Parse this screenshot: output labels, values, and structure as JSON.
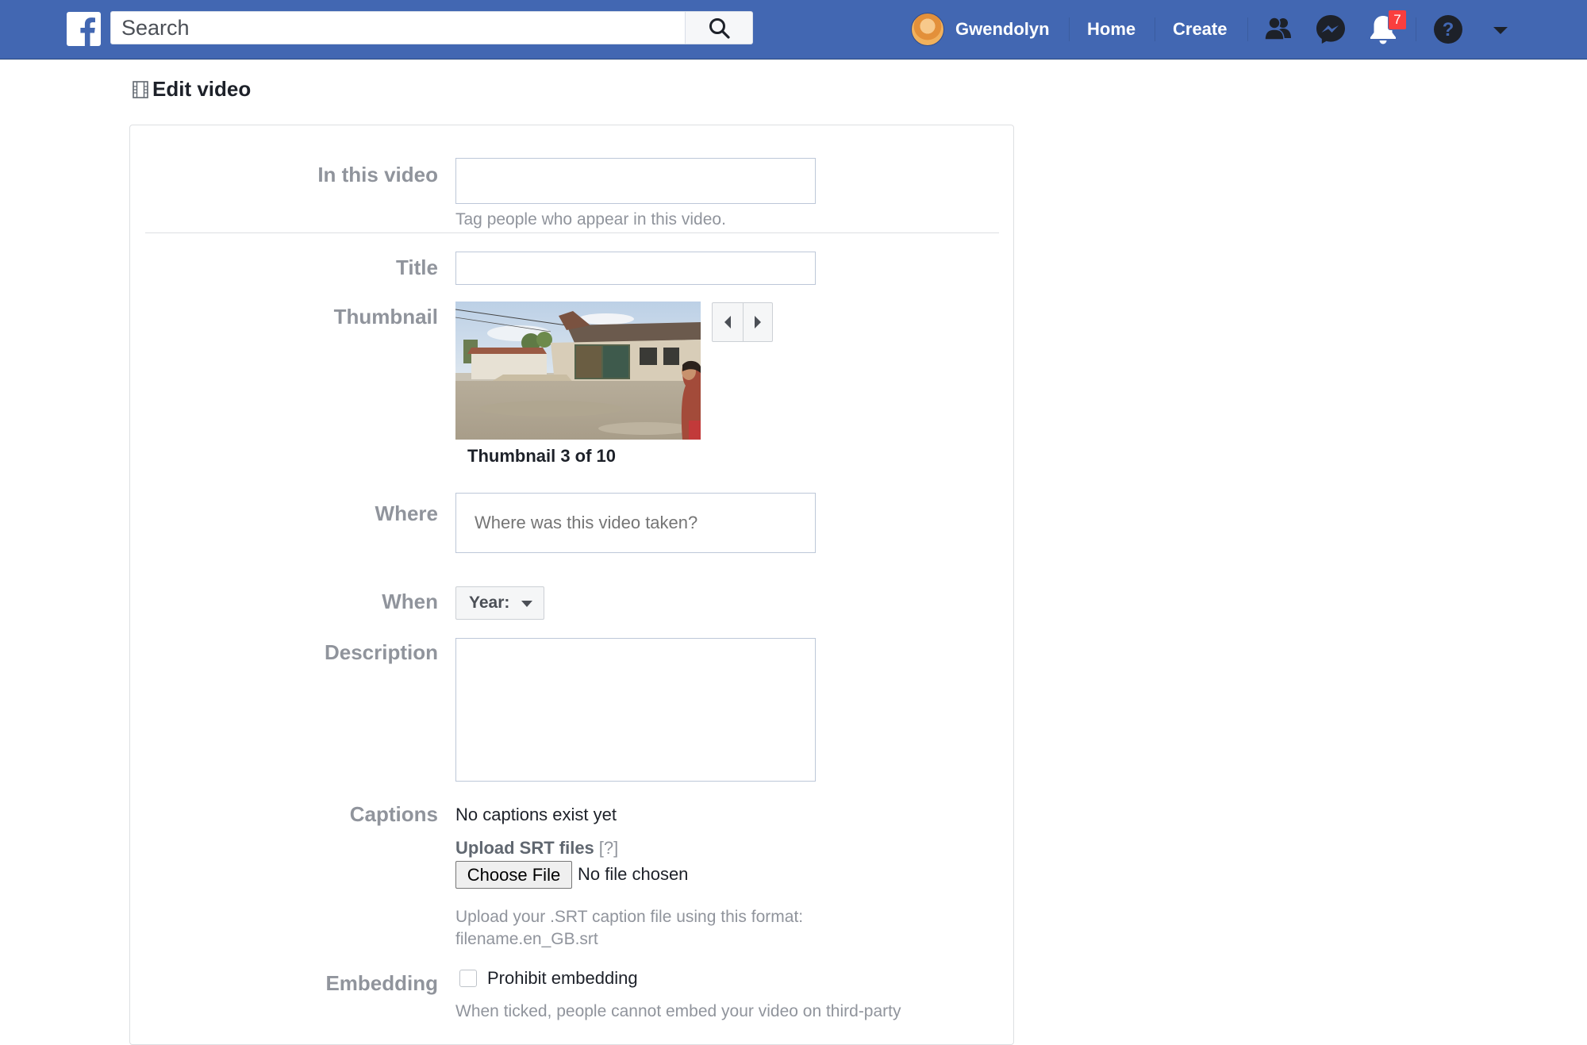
{
  "topbar": {
    "logo_icon": "facebook-f-logo-icon",
    "search_placeholder": "Search",
    "search_icon": "search-icon",
    "user_name": "Gwendolyn",
    "nav_home": "Home",
    "nav_create": "Create",
    "friends_icon": "friend-requests-icon",
    "messenger_icon": "messenger-icon",
    "notifications_icon": "notifications-bell-icon",
    "notifications_count": "7",
    "help_icon": "help-question-icon",
    "menu_icon": "caret-down-icon",
    "bar_color": "#4267b2"
  },
  "header": {
    "icon": "film-strip-icon",
    "title": "Edit video"
  },
  "form": {
    "in_this_video": {
      "label": "In this video",
      "value": "",
      "hint": "Tag people who appear in this video."
    },
    "title": {
      "label": "Title",
      "value": ""
    },
    "thumbnail": {
      "label": "Thumbnail",
      "caption": "Thumbnail 3 of 10",
      "current": 3,
      "total": 10,
      "prev_icon": "caret-left-icon",
      "next_icon": "caret-right-icon"
    },
    "where": {
      "label": "Where",
      "placeholder": "Where was this video taken?",
      "value": ""
    },
    "when": {
      "label": "When",
      "year_button": "Year:"
    },
    "description": {
      "label": "Description",
      "value": ""
    },
    "captions": {
      "label": "Captions",
      "status": "No captions exist yet",
      "upload_label": "Upload SRT files",
      "upload_help": "[?]",
      "choose_file": "Choose File",
      "no_file": "No file chosen",
      "format_hint_line1": "Upload your .SRT caption file using this format:",
      "format_hint_line2": "filename.en_GB.srt"
    },
    "embedding": {
      "label": "Embedding",
      "checkbox_label": "Prohibit embedding",
      "checked": false,
      "hint": "When ticked, people cannot embed your video on third-party"
    }
  }
}
